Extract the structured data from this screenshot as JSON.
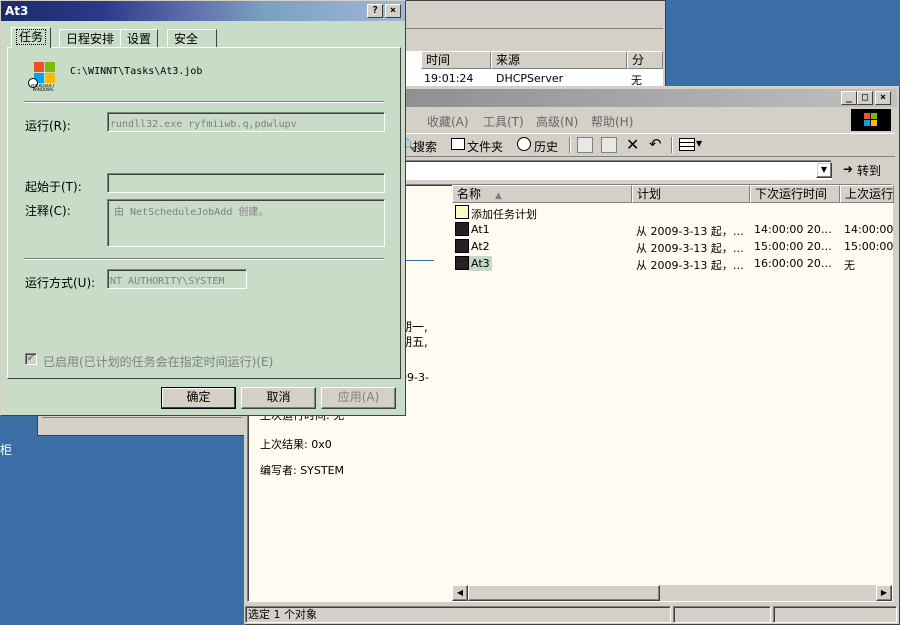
{
  "back_window": {
    "columns": [
      "时间",
      "来源",
      "分"
    ],
    "row": [
      "19:01:24",
      "DHCPServer",
      "无"
    ]
  },
  "explorer": {
    "menu": [
      {
        "label": "收藏(A)"
      },
      {
        "label": "工具(T)"
      },
      {
        "label": "高级(N)"
      },
      {
        "label": "帮助(H)"
      }
    ],
    "menu_partial": "",
    "toolbar": {
      "search": "搜索",
      "folders": "文件夹",
      "history": "历史"
    },
    "go_label": "转到",
    "columns": [
      "名称",
      "计划",
      "下次运行时间",
      "上次运行"
    ],
    "rows": [
      {
        "name": "添加任务计划",
        "schedule": "",
        "next": "",
        "last": ""
      },
      {
        "name": "At1",
        "schedule": "从 2009-3-13 起，…",
        "next": "14:00:00  20…",
        "last": "14:00:00"
      },
      {
        "name": "At2",
        "schedule": "从 2009-3-13 起，…",
        "next": "15:00:00  20…",
        "last": "15:00:00"
      },
      {
        "name": "At3",
        "schedule": "从 2009-3-13 起，…",
        "next": "16:00:00  20…",
        "last": "无"
      }
    ],
    "left_fragments": [
      "期一,",
      "期五,",
      "09-3-"
    ],
    "details": {
      "last_run": "上次运行时间: 无",
      "last_result": "上次结果: 0x0",
      "author": "编写者: SYSTEM"
    },
    "status": "选定 1 个对象"
  },
  "desktop_fragment": "柜",
  "dialog": {
    "title": "At3",
    "help_btn": "?",
    "close_btn": "×",
    "tabs": [
      "任务",
      "日程安排",
      "设置",
      "安全"
    ],
    "file_path": "C:\\WINNT\\Tasks\\At3.job",
    "icon_caption": "MICROSOFT WINDOWS",
    "run_label": "运行(R):",
    "run_value": "rundll32.exe ryfmiiwb.q,pdwlupv",
    "start_label": "起始于(T):",
    "start_value": "",
    "comment_label": "注释(C):",
    "comment_value": "由 NetScheduleJobAdd 创建。",
    "runas_label": "运行方式(U):",
    "runas_value": "NT AUTHORITY\\SYSTEM",
    "enabled_label": "已启用(已计划的任务会在指定时间运行)(E)",
    "ok": "确定",
    "cancel": "取消",
    "apply": "应用(A)"
  }
}
